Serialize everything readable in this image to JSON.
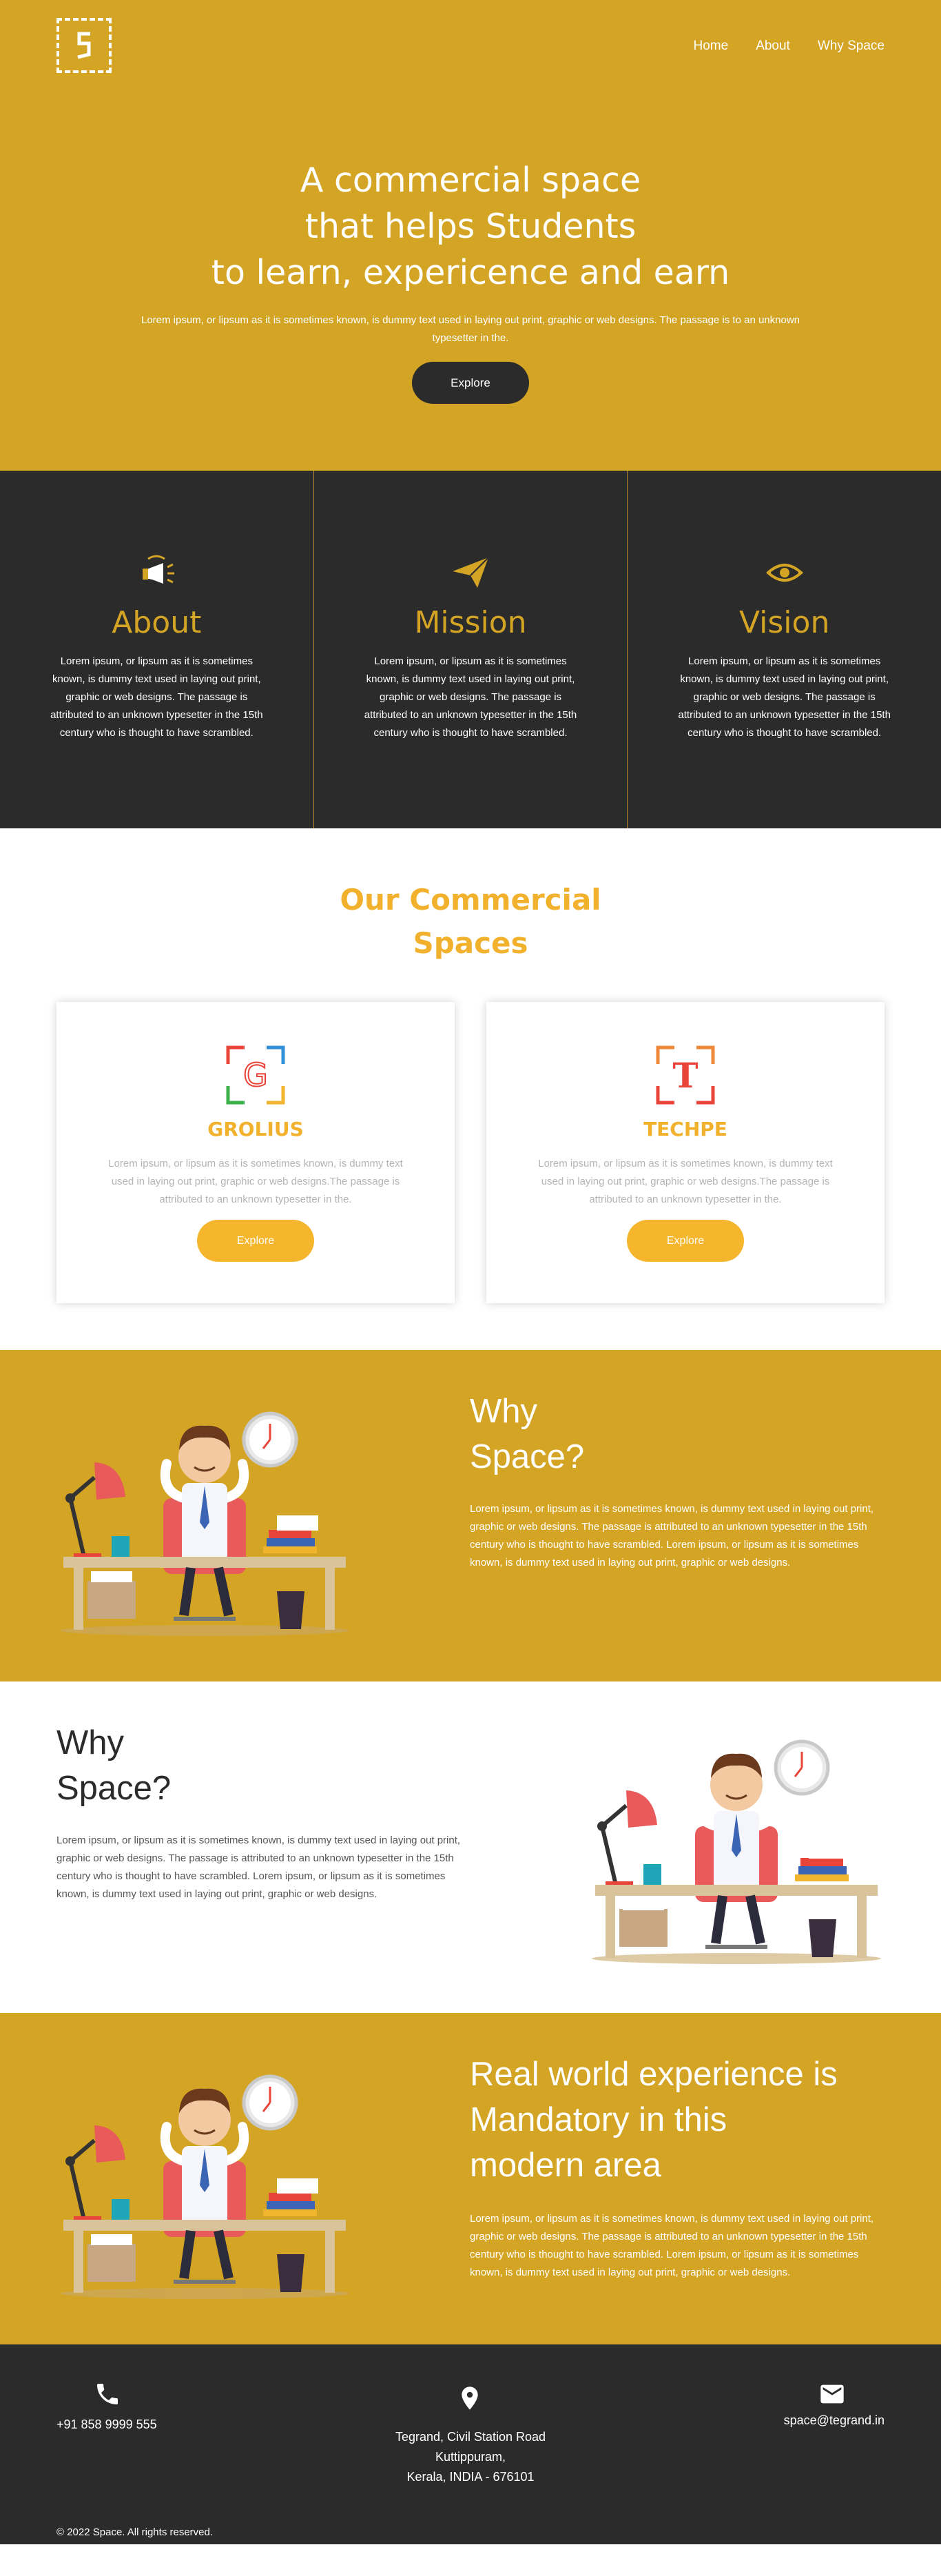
{
  "hero": {
    "nav": [
      "Home",
      "About",
      "Why Space"
    ],
    "title_lines": [
      "A commercial space",
      "that helps Students",
      "to learn, expericence and earn"
    ],
    "subtitle": "Lorem ipsum, or lipsum as it is sometimes known, is dummy text used in laying out print, graphic or web designs. The passage is to an unknown typesetter in the.",
    "button": "Explore",
    "bg_color": "#d4a424"
  },
  "features": [
    {
      "icon": "megaphone-icon",
      "title": "About",
      "text": "Lorem ipsum, or lipsum as it is sometimes known, is dummy text used in laying out print, graphic or web designs. The passage is attributed to an unknown typesetter in the 15th century who is thought to have scrambled."
    },
    {
      "icon": "paper-plane-icon",
      "title": "Mission",
      "text": "Lorem ipsum, or lipsum as it is sometimes known, is dummy text used in laying out print, graphic or web designs. The passage is attributed to an unknown typesetter in the 15th century who is thought to have scrambled."
    },
    {
      "icon": "eye-icon",
      "title": "Vision",
      "text": "Lorem ipsum, or lipsum as it is sometimes known, is dummy text used in laying out print, graphic or web designs. The passage is attributed to an unknown typesetter in the 15th century who is thought to have scrambled."
    }
  ],
  "spaces": {
    "title_lines": [
      "Our Commercial",
      "Spaces"
    ],
    "cards": [
      {
        "logo_letter": "G",
        "name": "GROLIUS",
        "text": "Lorem ipsum, or lipsum as it is sometimes known, is dummy text used in laying out print, graphic or web designs.The passage is attributed to an unknown typesetter in the.",
        "button": "Explore"
      },
      {
        "logo_letter": "T",
        "name": "TECHPE",
        "text": "Lorem ipsum, or lipsum as it is sometimes known, is dummy text used in laying out print, graphic or web designs.The passage is attributed to an unknown typesetter in the.",
        "button": "Explore"
      }
    ]
  },
  "why1": {
    "title_lines": [
      "Why",
      "Space?"
    ],
    "text": "Lorem ipsum, or lipsum as it is sometimes known, is dummy text used in laying out print, graphic or web designs. The passage is attributed to an unknown typesetter in the 15th century who is thought to have scrambled. Lorem ipsum, or lipsum as it is sometimes known, is dummy text used in laying out print, graphic or web designs."
  },
  "why2": {
    "title_lines": [
      "Why",
      "Space?"
    ],
    "text": "Lorem ipsum, or lipsum as it is sometimes known, is dummy text used in laying out print, graphic or web designs. The passage is attributed to an unknown typesetter in the 15th century who is thought to have scrambled. Lorem ipsum, or lipsum as it is sometimes known, is dummy text used in laying out print, graphic or web designs."
  },
  "real": {
    "title_lines": [
      "Real world experience is",
      "Mandatory in this",
      "modern area"
    ],
    "text": "Lorem ipsum, or lipsum as it is sometimes known, is dummy text used in laying out print, graphic or web designs. The passage is attributed to an unknown typesetter in the 15th century who is thought to have scrambled. Lorem ipsum, or lipsum as it is sometimes known, is dummy text used in laying out print, graphic or web designs."
  },
  "footer": {
    "phone": "+91 858 9999 555",
    "address_lines": [
      "Tegrand, Civil Station Road",
      "Kuttippuram,",
      "Kerala, INDIA - 676101"
    ],
    "email": "space@tegrand.in",
    "copyright": "© 2022 Space. All rights reserved."
  }
}
